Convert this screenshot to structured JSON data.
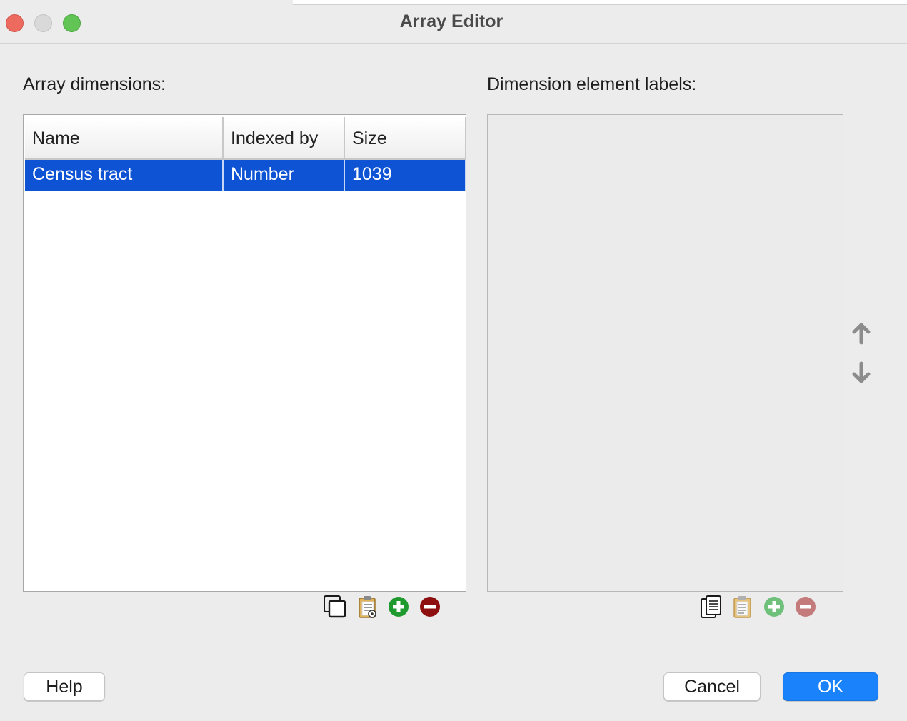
{
  "window": {
    "title": "Array Editor"
  },
  "left_panel": {
    "label": "Array dimensions:",
    "columns": [
      "Name",
      "Indexed by",
      "Size"
    ],
    "rows": [
      {
        "name": "Census tract",
        "indexed_by": "Number",
        "size": "1039"
      }
    ],
    "toolbar_icons": [
      "copy-icon",
      "paste-icon",
      "add-icon",
      "remove-icon"
    ]
  },
  "right_panel": {
    "label": "Dimension element labels:",
    "toolbar_icons": [
      "copy-list-icon",
      "paste-icon",
      "add-icon",
      "remove-icon"
    ],
    "move_icons": [
      "arrow-up-icon",
      "arrow-down-icon"
    ]
  },
  "buttons": {
    "help": "Help",
    "cancel": "Cancel",
    "ok": "OK"
  },
  "colors": {
    "selection": "#0f53d5",
    "primary_button": "#1a82fb",
    "add_green": "#1e9a2e",
    "remove_red": "#8e0f0f"
  }
}
